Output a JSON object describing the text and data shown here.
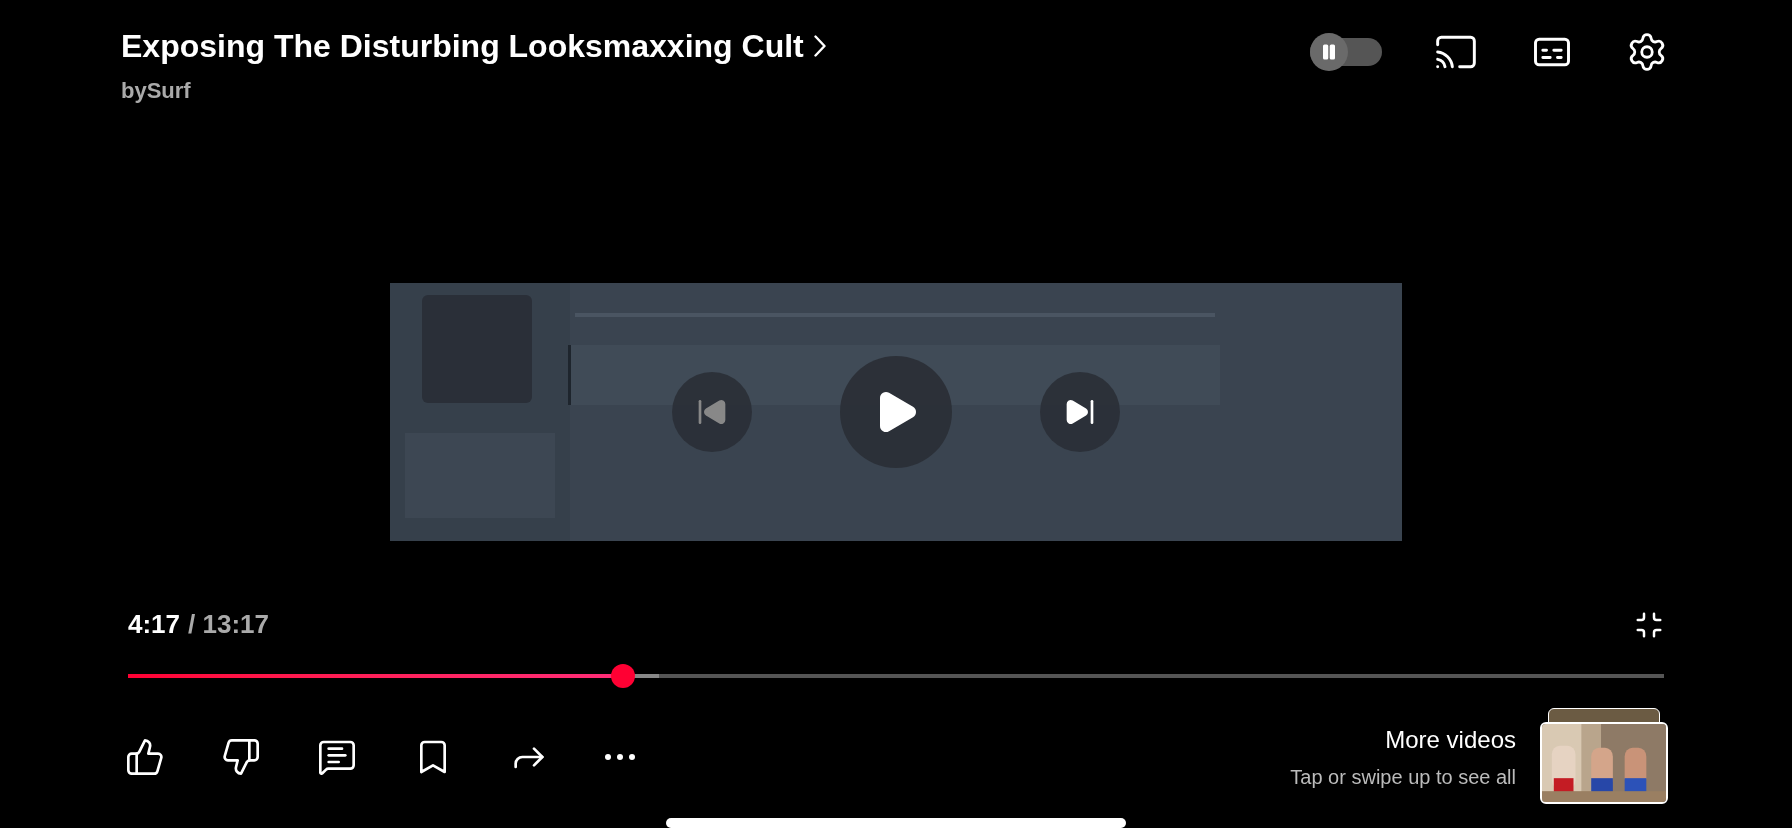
{
  "video": {
    "title": "Exposing The Disturbing Looksmaxxing Cult",
    "channel": "bySurf"
  },
  "autoplay": {
    "on": false
  },
  "playback": {
    "current": "4:17",
    "separator": "/ 13:17",
    "playing": false
  },
  "progress": {
    "level": 0.322
  },
  "buffer": {
    "level": 0.346
  },
  "actions": [
    {
      "kind": "like"
    },
    {
      "kind": "dislike"
    },
    {
      "kind": "comments"
    },
    {
      "kind": "save"
    },
    {
      "kind": "share"
    },
    {
      "kind": "more"
    }
  ],
  "more_videos": {
    "title": "More videos",
    "subtitle": "Tap or swipe up to see all"
  }
}
